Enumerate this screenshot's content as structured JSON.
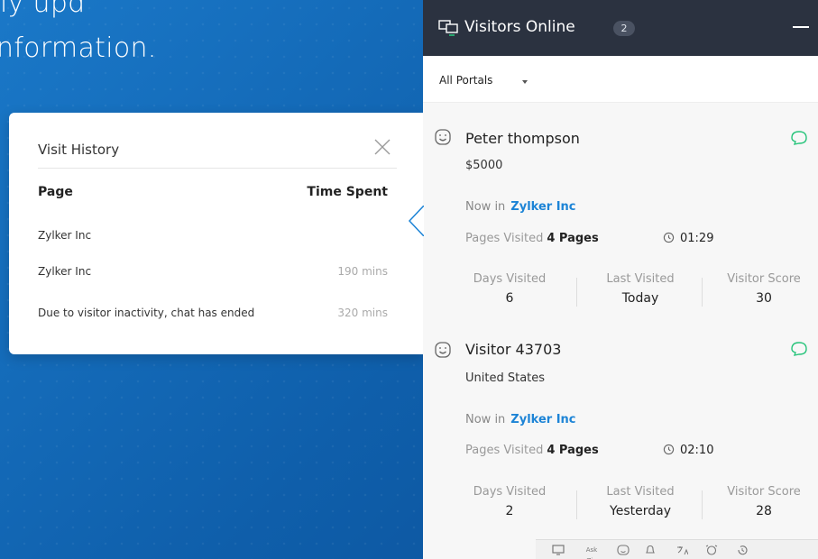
{
  "hero": {
    "line1": "ly upd",
    "line2": "nformation."
  },
  "visit_history": {
    "title": "Visit History",
    "columns": [
      "Page",
      "Time Spent"
    ],
    "rows": [
      {
        "page": "Zylker Inc",
        "time": ""
      },
      {
        "page": "Zylker Inc",
        "time": "190 mins"
      },
      {
        "page": "Due to visitor inactivity, chat has ended",
        "time": "320 mins"
      }
    ]
  },
  "visitors_online": {
    "title": "Visitors Online",
    "count": "2",
    "filter": "All Portals",
    "visitors": [
      {
        "name": "Peter thompson",
        "sub": "$5000",
        "now_in_label": "Now in",
        "now_in_value": "Zylker Inc",
        "pages_label": "Pages Visited",
        "pages_value": "4 Pages",
        "time": "01:29",
        "days_label": "Days Visited",
        "days_value": "6",
        "last_label": "Last Visited",
        "last_value": "Today",
        "score_label": "Visitor Score",
        "score_value": "30"
      },
      {
        "name": "Visitor 43703",
        "sub": "United States",
        "now_in_label": "Now in",
        "now_in_value": "Zylker Inc",
        "pages_label": "Pages Visited",
        "pages_value": "4 Pages",
        "time": "02:10",
        "days_label": "Days Visited",
        "days_value": "2",
        "last_label": "Last Visited",
        "last_value": "Yesterday",
        "score_label": "Visitor Score",
        "score_value": "28"
      }
    ]
  },
  "toolbar": {
    "items": [
      "monitor-icon",
      "ask-zia",
      "smiley-icon",
      "bell-icon",
      "translate-icon",
      "alarm-icon",
      "history-icon"
    ],
    "ask_zia_label": "Ask Zia"
  },
  "colors": {
    "background": "#1268b8",
    "header": "#2b3240",
    "link": "#1d84d6",
    "chat_green": "#27c47b"
  }
}
